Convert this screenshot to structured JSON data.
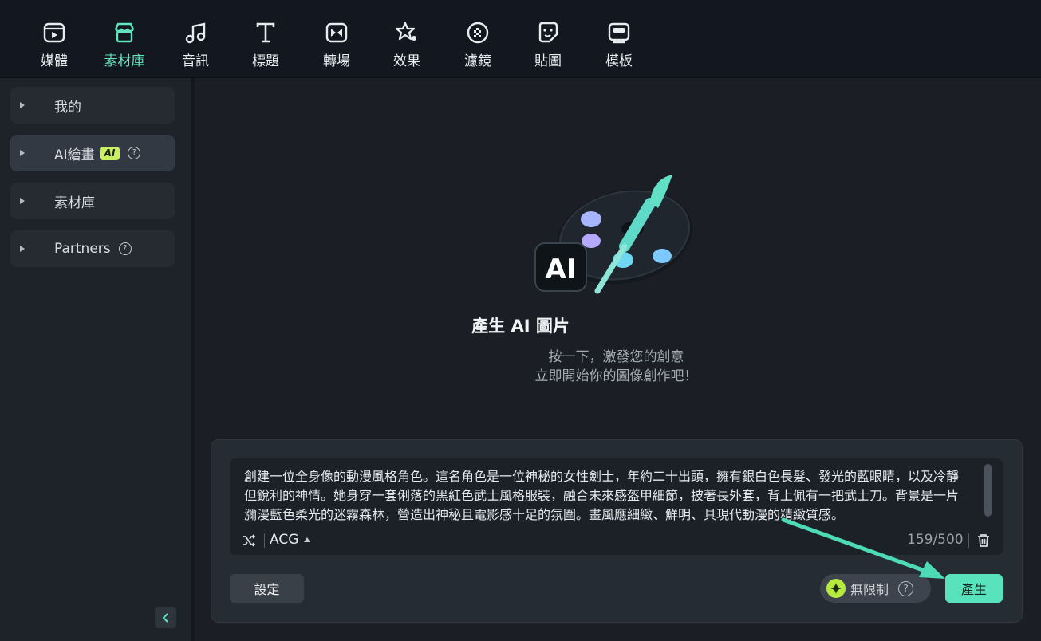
{
  "toolbar": {
    "items": [
      {
        "label": "媒體",
        "icon": "media-icon"
      },
      {
        "label": "素材庫",
        "icon": "store-icon",
        "active": true
      },
      {
        "label": "音訊",
        "icon": "music-note-icon"
      },
      {
        "label": "標題",
        "icon": "title-text-icon"
      },
      {
        "label": "轉場",
        "icon": "transition-icon"
      },
      {
        "label": "效果",
        "icon": "effects-star-icon"
      },
      {
        "label": "濾鏡",
        "icon": "filter-icon"
      },
      {
        "label": "貼圖",
        "icon": "sticker-icon"
      },
      {
        "label": "模板",
        "icon": "template-icon"
      }
    ]
  },
  "sidebar": {
    "items": [
      {
        "label": "我的"
      },
      {
        "label": "AI繪畫",
        "badge": "AI",
        "active": true
      },
      {
        "label": "素材庫"
      },
      {
        "label": "Partners"
      }
    ],
    "help_symbol": "?"
  },
  "hero": {
    "title": "產生 AI 圖片",
    "subtitle_line1": "按一下，激發您的創意",
    "subtitle_line2": "立即開始你的圖像創作吧！",
    "illustration_text": "AI"
  },
  "prompt": {
    "text": "創建一位全身像的動漫風格角色。這名角色是一位神秘的女性劍士，年約二十出頭，擁有銀白色長髮、發光的藍眼睛，以及冷靜但銳利的神情。她身穿一套俐落的黑紅色武士風格服裝，融合未來感盔甲細節，披著長外套，背上佩有一把武士刀。背景是一片瀰漫藍色柔光的迷霧森林，營造出神秘且電影感十足的氛圍。畫風應細緻、鮮明、具現代動漫的精緻質感。",
    "style": "ACG",
    "counter": "159/500"
  },
  "actions": {
    "settings_label": "設定",
    "unlimited_label": "無限制",
    "generate_label": "產生"
  },
  "colors": {
    "accent": "#59e3bd",
    "active_label": "#63e6be",
    "ai_badge": "#c8f060"
  }
}
